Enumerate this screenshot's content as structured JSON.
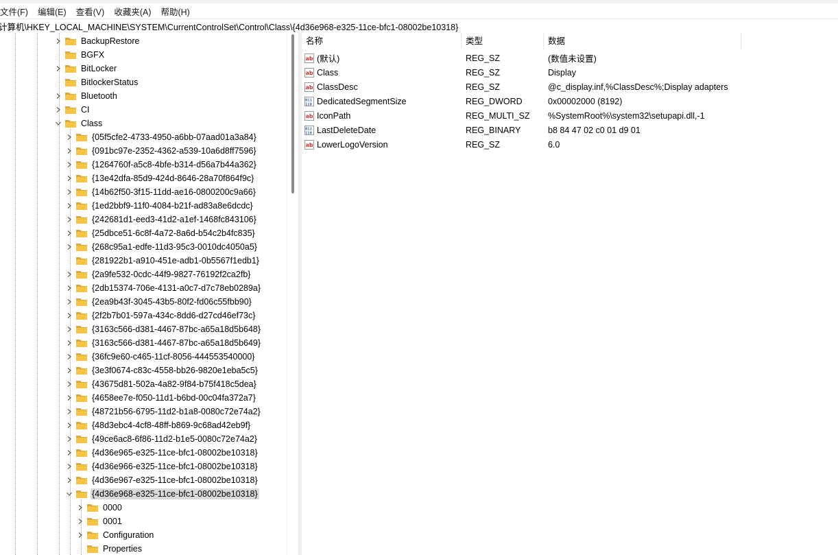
{
  "menu": [
    "文件(F)",
    "编辑(E)",
    "查看(V)",
    "收藏夹(A)",
    "帮助(H)"
  ],
  "address": "计算机\\HKEY_LOCAL_MACHINE\\SYSTEM\\CurrentControlSet\\Control\\Class\\{4d36e968-e325-11ce-bfc1-08002be10318}",
  "tree": [
    {
      "label": "BackupRestore",
      "level": 0,
      "chevron": "right"
    },
    {
      "label": "BGFX",
      "level": 0,
      "chevron": "none"
    },
    {
      "label": "BitLocker",
      "level": 0,
      "chevron": "right"
    },
    {
      "label": "BitlockerStatus",
      "level": 0,
      "chevron": "none"
    },
    {
      "label": "Bluetooth",
      "level": 0,
      "chevron": "right"
    },
    {
      "label": "CI",
      "level": 0,
      "chevron": "right"
    },
    {
      "label": "Class",
      "level": 0,
      "chevron": "down"
    },
    {
      "label": "{05f5cfe2-4733-4950-a6bb-07aad01a3a84}",
      "level": 1,
      "chevron": "right"
    },
    {
      "label": "{091bc97e-2352-4362-a539-10a6d8ff7596}",
      "level": 1,
      "chevron": "right"
    },
    {
      "label": "{1264760f-a5c8-4bfe-b314-d56a7b44a362}",
      "level": 1,
      "chevron": "right"
    },
    {
      "label": "{13e42dfa-85d9-424d-8646-28a70f864f9c}",
      "level": 1,
      "chevron": "right"
    },
    {
      "label": "{14b62f50-3f15-11dd-ae16-0800200c9a66}",
      "level": 1,
      "chevron": "right"
    },
    {
      "label": "{1ed2bbf9-11f0-4084-b21f-ad83a8e6dcdc}",
      "level": 1,
      "chevron": "right"
    },
    {
      "label": "{242681d1-eed3-41d2-a1ef-1468fc843106}",
      "level": 1,
      "chevron": "right"
    },
    {
      "label": "{25dbce51-6c8f-4a72-8a6d-b54c2b4fc835}",
      "level": 1,
      "chevron": "right"
    },
    {
      "label": "{268c95a1-edfe-11d3-95c3-0010dc4050a5}",
      "level": 1,
      "chevron": "right"
    },
    {
      "label": "{281922b1-a910-451e-adb1-0b5567f1edb1}",
      "level": 1,
      "chevron": "none"
    },
    {
      "label": "{2a9fe532-0cdc-44f9-9827-76192f2ca2fb}",
      "level": 1,
      "chevron": "right"
    },
    {
      "label": "{2db15374-706e-4131-a0c7-d7c78eb0289a}",
      "level": 1,
      "chevron": "right"
    },
    {
      "label": "{2ea9b43f-3045-43b5-80f2-fd06c55fbb90}",
      "level": 1,
      "chevron": "right"
    },
    {
      "label": "{2f2b7b01-597a-434c-8dd6-d27cd46ef73c}",
      "level": 1,
      "chevron": "right"
    },
    {
      "label": "{3163c566-d381-4467-87bc-a65a18d5b648}",
      "level": 1,
      "chevron": "right"
    },
    {
      "label": "{3163c566-d381-4467-87bc-a65a18d5b649}",
      "level": 1,
      "chevron": "right"
    },
    {
      "label": "{36fc9e60-c465-11cf-8056-444553540000}",
      "level": 1,
      "chevron": "right"
    },
    {
      "label": "{3e3f0674-c83c-4558-bb26-9820e1eba5c5}",
      "level": 1,
      "chevron": "right"
    },
    {
      "label": "{43675d81-502a-4a82-9f84-b75f418c5dea}",
      "level": 1,
      "chevron": "right"
    },
    {
      "label": "{4658ee7e-f050-11d1-b6bd-00c04fa372a7}",
      "level": 1,
      "chevron": "right"
    },
    {
      "label": "{48721b56-6795-11d2-b1a8-0080c72e74a2}",
      "level": 1,
      "chevron": "right"
    },
    {
      "label": "{48d3ebc4-4cf8-48ff-b869-9c68ad42eb9f}",
      "level": 1,
      "chevron": "right"
    },
    {
      "label": "{49ce6ac8-6f86-11d2-b1e5-0080c72e74a2}",
      "level": 1,
      "chevron": "right"
    },
    {
      "label": "{4d36e965-e325-11ce-bfc1-08002be10318}",
      "level": 1,
      "chevron": "right"
    },
    {
      "label": "{4d36e966-e325-11ce-bfc1-08002be10318}",
      "level": 1,
      "chevron": "right"
    },
    {
      "label": "{4d36e967-e325-11ce-bfc1-08002be10318}",
      "level": 1,
      "chevron": "right"
    },
    {
      "label": "{4d36e968-e325-11ce-bfc1-08002be10318}",
      "level": 1,
      "chevron": "down",
      "selected": true
    },
    {
      "label": "0000",
      "level": 2,
      "chevron": "right"
    },
    {
      "label": "0001",
      "level": 2,
      "chevron": "right"
    },
    {
      "label": "Configuration",
      "level": 2,
      "chevron": "right"
    },
    {
      "label": "Properties",
      "level": 2,
      "chevron": "none"
    }
  ],
  "columns": [
    "名称",
    "类型",
    "数据"
  ],
  "values": [
    {
      "name": "(默认)",
      "type": "REG_SZ",
      "data": "(数值未设置)",
      "icon": "string-value-icon"
    },
    {
      "name": "Class",
      "type": "REG_SZ",
      "data": "Display",
      "icon": "string-value-icon"
    },
    {
      "name": "ClassDesc",
      "type": "REG_SZ",
      "data": "@c_display.inf,%ClassDesc%;Display adapters",
      "icon": "string-value-icon"
    },
    {
      "name": "DedicatedSegmentSize",
      "type": "REG_DWORD",
      "data": "0x00002000 (8192)",
      "icon": "binary-value-icon"
    },
    {
      "name": "IconPath",
      "type": "REG_MULTI_SZ",
      "data": "%SystemRoot%\\system32\\setupapi.dll,-1",
      "icon": "string-value-icon"
    },
    {
      "name": "LastDeleteDate",
      "type": "REG_BINARY",
      "data": "b8 84 47 02 c0 01 d9 01",
      "icon": "binary-value-icon"
    },
    {
      "name": "LowerLogoVersion",
      "type": "REG_SZ",
      "data": "6.0",
      "icon": "string-value-icon"
    }
  ],
  "colors": {
    "folder": "#f7c543",
    "folder_dark": "#e0a82e",
    "selected": "#d9d9d9",
    "ab_red": "#c8352f",
    "bin_blue": "#2c5aa0"
  }
}
